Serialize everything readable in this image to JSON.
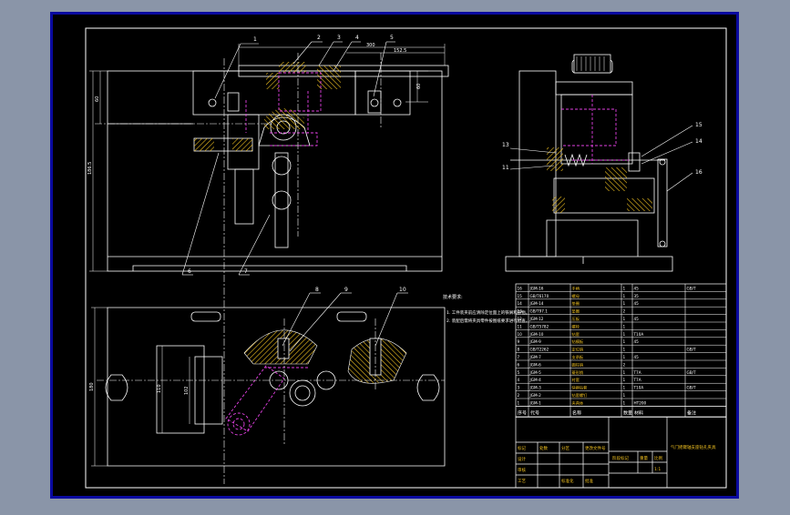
{
  "drawing": {
    "balloons_front": [
      "1",
      "2",
      "3",
      "4",
      "5"
    ],
    "balloons_front_lower": [
      "6",
      "7"
    ],
    "balloons_plan": [
      "8",
      "9",
      "10"
    ],
    "balloons_side": [
      "13",
      "11",
      "15",
      "14",
      "16"
    ],
    "dims": {
      "top_width": "300",
      "top_offset": "152.5",
      "top_height": "60",
      "left_v1": "60",
      "left_v2": "186.5",
      "plan_left": "180",
      "plan_inner": "110",
      "plan_inner2": "102"
    },
    "tech_req_title": "技术要求:",
    "tech_req_lines": [
      "1. 工件装夹前应清除定位面上的铁屑和杂物。",
      "2. 装配后需将夹具零件按图纸要求进行检查。"
    ],
    "bom_rows": [
      [
        "16",
        "JGM-16",
        "手柄",
        "1",
        "45",
        "GB/T"
      ],
      [
        "15",
        "GB/T6170",
        "螺母",
        "1",
        "35",
        ""
      ],
      [
        "14",
        "JGM-14",
        "垫圈",
        "1",
        "45",
        ""
      ],
      [
        "13",
        "GB/T97.1",
        "垫圈",
        "2",
        "",
        ""
      ],
      [
        "12",
        "JGM-12",
        "压板",
        "1",
        "45",
        ""
      ],
      [
        "11",
        "GB/T5782",
        "螺栓",
        "1",
        "",
        ""
      ],
      [
        "10",
        "JGM-10",
        "钻套",
        "1",
        "T10A",
        ""
      ],
      [
        "9",
        "JGM-9",
        "钻模板",
        "1",
        "45",
        ""
      ],
      [
        "8",
        "GB/T2262",
        "定位销",
        "1",
        "",
        "GB/T"
      ],
      [
        "7",
        "JGM-7",
        "支承板",
        "1",
        "45",
        ""
      ],
      [
        "6",
        "JGM-6",
        "圆柱销",
        "2",
        "",
        ""
      ],
      [
        "5",
        "JGM-5",
        "菱形销",
        "1",
        "T7A",
        "GB/T"
      ],
      [
        "4",
        "JGM-4",
        "衬套",
        "1",
        "T7A",
        ""
      ],
      [
        "3",
        "JGM-3",
        "快换钻套",
        "1",
        "T10A",
        "GB/T"
      ],
      [
        "2",
        "JGM-2",
        "钻套螺钉",
        "1",
        "",
        ""
      ],
      [
        "1",
        "JGM-1",
        "夹具体",
        "1",
        "HT200",
        ""
      ]
    ],
    "bom_header": [
      "序号",
      "代号",
      "名称",
      "数量",
      "材料",
      "备注"
    ],
    "title_block": {
      "drawing_title": "气门摇臂轴支座钻孔夹具",
      "marks": [
        "标记",
        "处数",
        "分区",
        "更改文件号",
        "签名",
        "年月日"
      ],
      "roles": [
        "设计",
        "审核",
        "工艺",
        "标准化",
        "批准"
      ],
      "stage_label": "阶段标记",
      "weight_label": "重量",
      "scale_label": "比例",
      "scale": "1:1"
    }
  },
  "colors": {
    "background": "#000000",
    "frame": "#ffffff",
    "centerline": "#ffffff",
    "hidden": "#e040e0",
    "hatch": "#f0c020",
    "dim": "#ffffff",
    "window_bg": "#8a95a8",
    "outer_border": "#0a0aa0"
  }
}
